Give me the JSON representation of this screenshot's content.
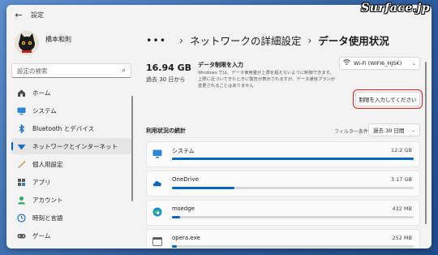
{
  "watermark": "Surface.jp",
  "window": {
    "title": "設定"
  },
  "user": {
    "name": "橋本和則"
  },
  "search": {
    "placeholder": "設定の検索"
  },
  "sidebar": {
    "items": [
      {
        "label": "ホーム",
        "icon": "home-icon",
        "active": false
      },
      {
        "label": "システム",
        "icon": "system-icon",
        "active": false
      },
      {
        "label": "Bluetooth とデバイス",
        "icon": "bluetooth-icon",
        "active": false
      },
      {
        "label": "ネットワークとインターネット",
        "icon": "network-icon",
        "active": true
      },
      {
        "label": "個人用設定",
        "icon": "personalization-icon",
        "active": false
      },
      {
        "label": "アプリ",
        "icon": "apps-icon",
        "active": false
      },
      {
        "label": "アカウント",
        "icon": "account-icon",
        "active": false
      },
      {
        "label": "時刻と言語",
        "icon": "time-language-icon",
        "active": false
      },
      {
        "label": "ゲーム",
        "icon": "gaming-icon",
        "active": false
      }
    ]
  },
  "breadcrumb": {
    "more": "•••",
    "parent": "ネットワークの詳細設定",
    "current": "データ使用状況"
  },
  "usage": {
    "total": "16.94 GB",
    "period": "過去 30 日から"
  },
  "limit": {
    "title": "データ制限を入力",
    "description": "Windows では、データ使用量が上限を超えないように制御できます。上限に近づいてきたときに警告が表示されますが、データ通信プランが変更されることはありません",
    "button_label": "制限を入力してください"
  },
  "network_select": {
    "value": "Wi-Fi (WIFI6_HJSK)"
  },
  "stats": {
    "heading": "利用状況の統計",
    "filter_label": "フィルター条件:",
    "filter_value": "過去 30 日間"
  },
  "apps": [
    {
      "name": "システム",
      "size": "12.2 GB",
      "usage_fraction": 1.0,
      "icon": "system-app-icon"
    },
    {
      "name": "OneDrive",
      "size": "3.17 GB",
      "usage_fraction": 0.26,
      "icon": "onedrive-icon"
    },
    {
      "name": "msedge",
      "size": "432 MB",
      "usage_fraction": 0.035,
      "icon": "edge-icon"
    },
    {
      "name": "opera.exe",
      "size": "252 MB",
      "usage_fraction": 0.02,
      "icon": "app-window-icon"
    }
  ],
  "colors": {
    "accent": "#0067c0",
    "highlight_outline": "#e41f1f"
  }
}
